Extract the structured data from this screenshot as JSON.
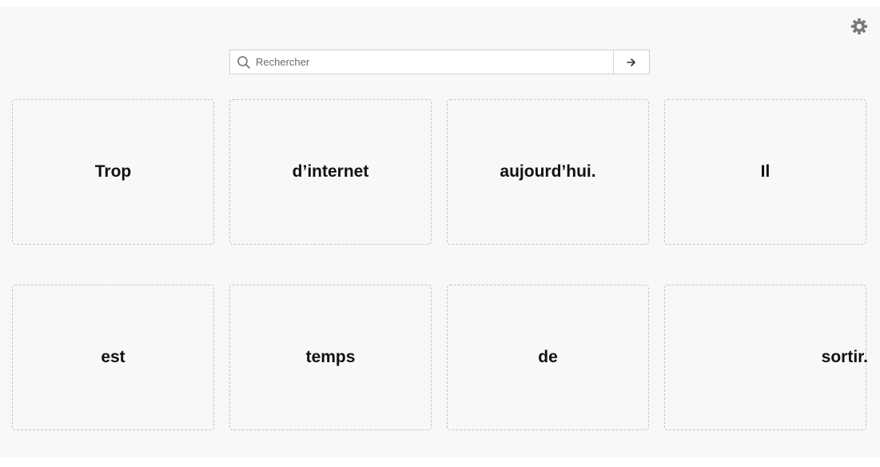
{
  "search": {
    "placeholder": "Rechercher",
    "value": ""
  },
  "icons": {
    "settings": "gear-icon",
    "search": "search-icon",
    "submit": "arrow-right-icon"
  },
  "cards": [
    {
      "word": "Trop"
    },
    {
      "word": "d’internet"
    },
    {
      "word": "aujourd’hui."
    },
    {
      "word": "Il"
    },
    {
      "word": "est"
    },
    {
      "word": "temps"
    },
    {
      "word": "de"
    },
    {
      "word": "sortir."
    }
  ],
  "colors": {
    "background": "#f8f8f8",
    "card_border": "#c4c4c4",
    "text": "#111111",
    "icon": "#7a7a7a"
  }
}
